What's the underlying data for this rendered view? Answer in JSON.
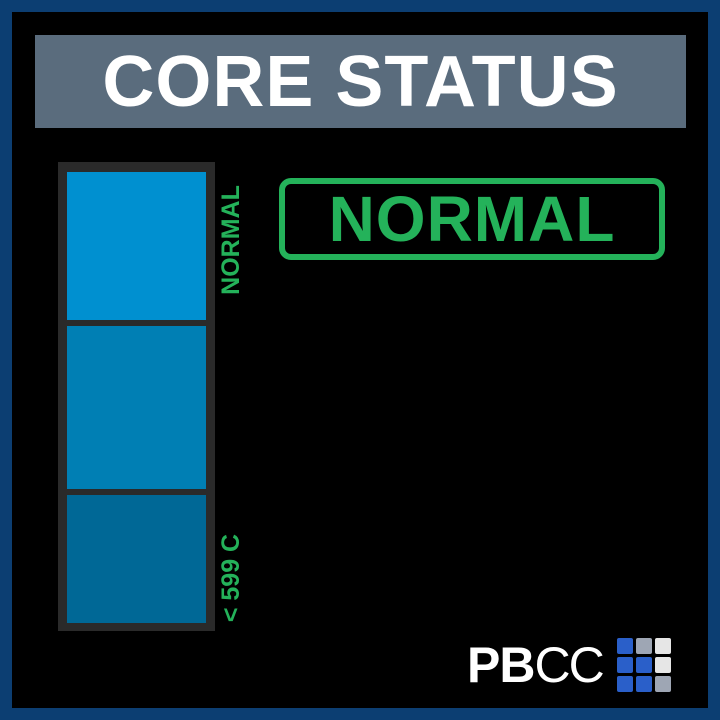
{
  "header": {
    "title": "CORE STATUS"
  },
  "gauge": {
    "top_label": "NORMAL",
    "bottom_label": "< 599 C",
    "segments": [
      "top",
      "middle",
      "bottom"
    ],
    "colors": [
      "#0090d0",
      "#007fb4",
      "#006896"
    ]
  },
  "status": {
    "text": "NORMAL",
    "color": "#24b25a"
  },
  "logo": {
    "bold": "PB",
    "light": "CC",
    "icon": "cube-grid-icon"
  },
  "colors": {
    "frame": "#0c3e72",
    "title_bar": "#5a6c7d",
    "accent_green": "#24b25a"
  }
}
